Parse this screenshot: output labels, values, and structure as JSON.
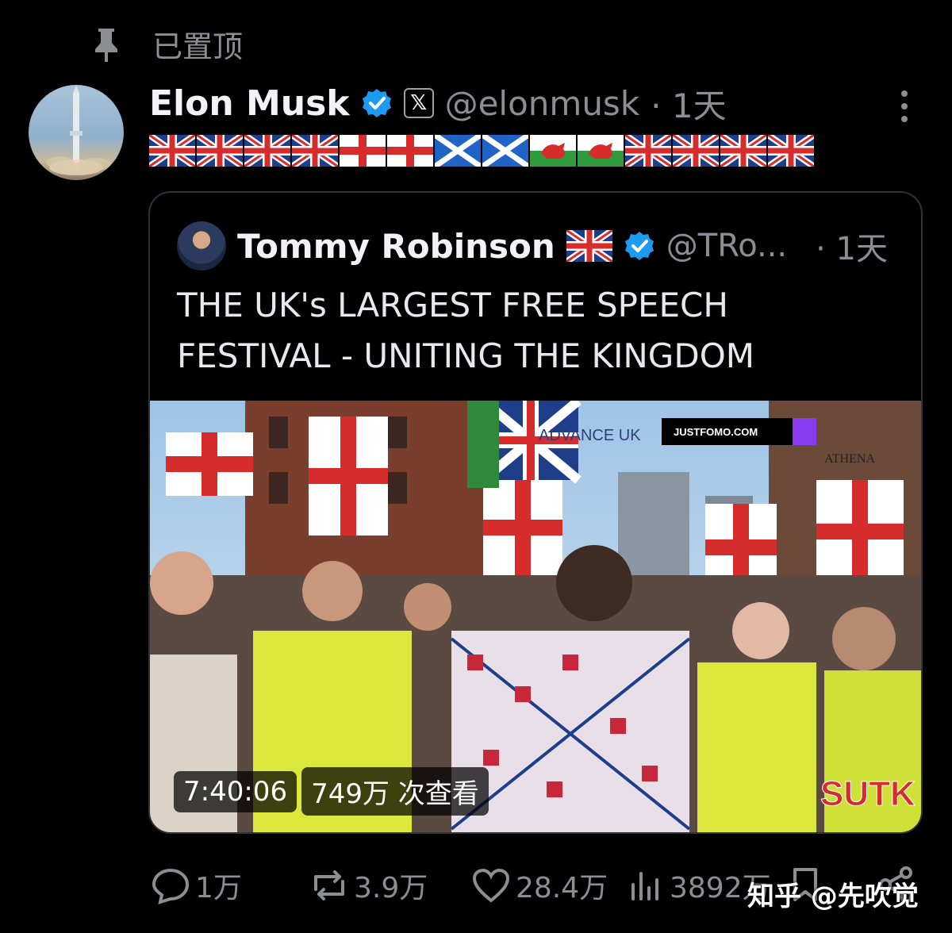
{
  "pinned_label": "已置顶",
  "author": {
    "name": "Elon Musk",
    "handle": "@elonmusk",
    "time": "· 1天"
  },
  "flags": [
    "uk",
    "uk",
    "uk",
    "uk",
    "england",
    "england",
    "scotland",
    "scotland",
    "wales",
    "wales",
    "uk",
    "uk",
    "uk",
    "uk"
  ],
  "quote": {
    "name": "Tommy Robinson",
    "handle": "@TRo...",
    "time": "· 1天",
    "text_line1": "THE UK's LARGEST FREE SPEECH",
    "text_line2": "FESTIVAL - UNITING THE KINGDOM",
    "video": {
      "duration": "7:40:06",
      "views": "749万 次查看",
      "logo_advance": "ADVANCE UK",
      "logo_justfomo": "JUSTFOMO.COM",
      "logo_athena": "ATHENA",
      "logo_sutk": "SUTK"
    }
  },
  "actions": {
    "replies": "1万",
    "reposts": "3.9万",
    "likes": "28.4万",
    "views": "3892万"
  },
  "watermark": "知乎 @先吹觉",
  "colors": {
    "verified": "#1d9bf0",
    "muted": "#8b8f94",
    "border": "#2f3336"
  }
}
